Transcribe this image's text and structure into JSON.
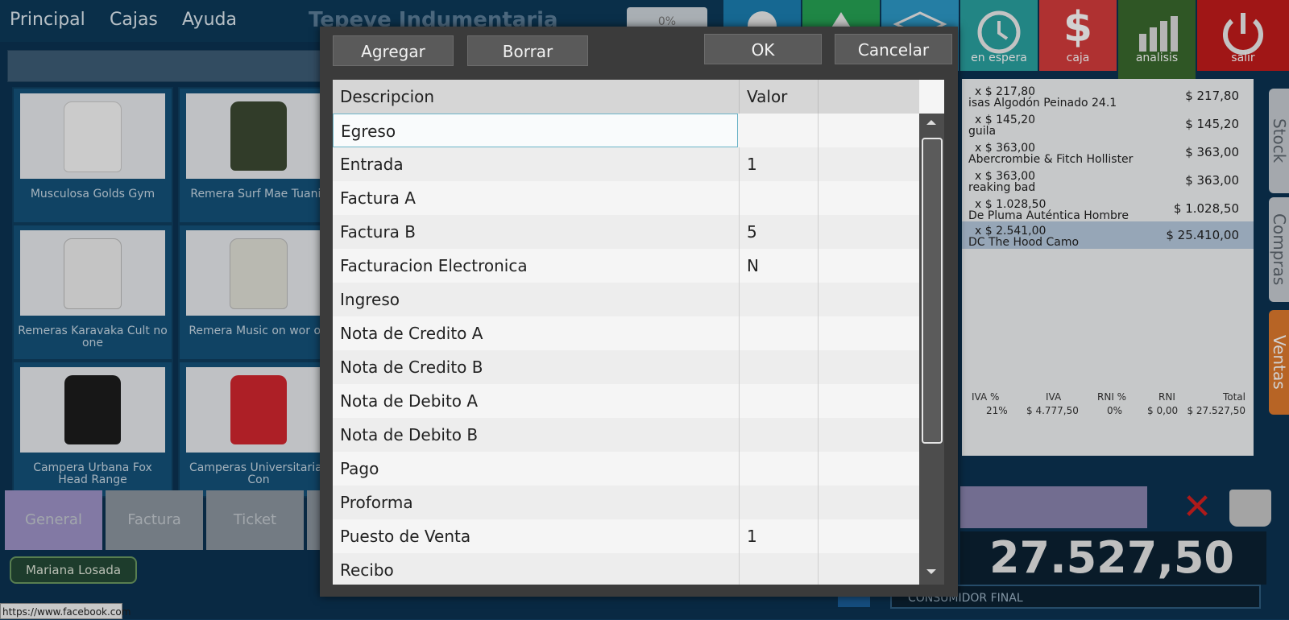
{
  "menu": {
    "items": [
      "Principal",
      "Cajas",
      "Ayuda"
    ],
    "brand": "Tepeve Indumentaria",
    "discount": "0%"
  },
  "products": [
    {
      "name": "Musculosa Golds Gym",
      "color": "#f3f3f3"
    },
    {
      "name": "Remera Surf Mae Tuanis",
      "color": "#3c4a33"
    },
    {
      "name": "Remeras Karavaka Cult no one",
      "color": "#f0f0f0"
    },
    {
      "name": "Remera Music on wor off",
      "color": "#e8e8e2"
    },
    {
      "name": "Campera Urbana Fox Head Range",
      "color": "#1d1d1d"
    },
    {
      "name": "Camperas Universitarias Con",
      "color": "#d4262f"
    }
  ],
  "bottom_tabs": [
    "General",
    "Factura",
    "Ticket"
  ],
  "user": "Mariana Losada",
  "status_url": "https://www.facebook.com",
  "top_buttons": [
    {
      "label": "",
      "color": "#1c7fb3"
    },
    {
      "label": "",
      "color": "#26a455"
    },
    {
      "label": "",
      "color": "#2e9ac9"
    },
    {
      "label": "en espera",
      "color": "#2aa3a1"
    },
    {
      "label": "caja",
      "color": "#d63c3c"
    },
    {
      "label": "analisis",
      "color": "#3a6a2e"
    },
    {
      "label": "salir",
      "color": "#c41b1b"
    }
  ],
  "cart": {
    "lines": [
      {
        "qty": "x  $ 217,80",
        "desc": "isas Algodón Peinado 24.1",
        "total": "$ 217,80"
      },
      {
        "qty": "x  $ 145,20",
        "desc": "guila",
        "total": "$ 145,20"
      },
      {
        "qty": "x  $ 363,00",
        "desc": "Abercrombie & Fitch Hollister",
        "total": "$ 363,00"
      },
      {
        "qty": "x  $ 363,00",
        "desc": "reaking bad",
        "total": "$ 363,00"
      },
      {
        "qty": "x  $ 1.028,50",
        "desc": "De Pluma Auténtica Hombre",
        "total": "$ 1.028,50"
      },
      {
        "qty": "x  $ 2.541,00",
        "desc": "DC The Hood Camo",
        "total": "$ 25.410,00"
      }
    ],
    "totals_head": [
      "IVA %",
      "IVA",
      "RNI %",
      "RNI",
      "Total"
    ],
    "totals_vals": [
      "21%",
      "$ 4.777,50",
      "0%",
      "$ 0,00",
      "$ 27.527,50"
    ],
    "big_total": "27.527,50",
    "cliente": "CONSUMIDOR FINAL",
    "side_tabs": [
      "Stock",
      "Compras",
      "Ventas"
    ]
  },
  "dialog": {
    "buttons": {
      "agregar": "Agregar",
      "borrar": "Borrar",
      "ok": "OK",
      "cancelar": "Cancelar"
    },
    "columns": [
      "Descripcion",
      "Valor"
    ],
    "rows": [
      {
        "desc": "Egreso",
        "valor": ""
      },
      {
        "desc": "Entrada",
        "valor": "1"
      },
      {
        "desc": "Factura A",
        "valor": ""
      },
      {
        "desc": "Factura B",
        "valor": "5"
      },
      {
        "desc": "Facturacion Electronica",
        "valor": "N"
      },
      {
        "desc": "Ingreso",
        "valor": ""
      },
      {
        "desc": "Nota de Credito A",
        "valor": ""
      },
      {
        "desc": "Nota de Credito B",
        "valor": ""
      },
      {
        "desc": "Nota de Debito A",
        "valor": ""
      },
      {
        "desc": "Nota de Debito B",
        "valor": ""
      },
      {
        "desc": "Pago",
        "valor": ""
      },
      {
        "desc": "Proforma",
        "valor": ""
      },
      {
        "desc": "Puesto de Venta",
        "valor": "1"
      },
      {
        "desc": "Recibo",
        "valor": ""
      }
    ]
  }
}
